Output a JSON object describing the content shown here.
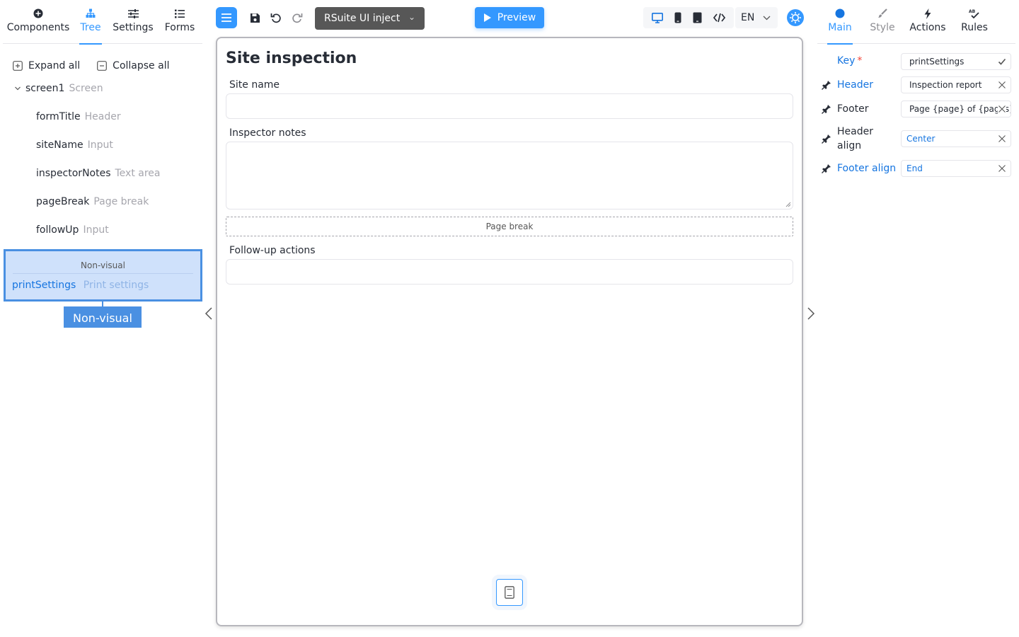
{
  "left_panel": {
    "tabs": [
      {
        "label": "Components",
        "icon": "plus-circle-icon"
      },
      {
        "label": "Tree",
        "icon": "tree-icon",
        "active": true
      },
      {
        "label": "Settings",
        "icon": "sliders-icon"
      },
      {
        "label": "Forms",
        "icon": "list-icon"
      }
    ],
    "expand_all": "Expand all",
    "collapse_all": "Collapse all",
    "tree": {
      "root": {
        "name": "screen1",
        "type": "Screen"
      },
      "children": [
        {
          "name": "formTitle",
          "type": "Header"
        },
        {
          "name": "siteName",
          "type": "Input"
        },
        {
          "name": "inspectorNotes",
          "type": "Text area"
        },
        {
          "name": "pageBreak",
          "type": "Page break"
        },
        {
          "name": "followUp",
          "type": "Input"
        }
      ]
    },
    "non_visual": {
      "header": "Non-visual",
      "item": {
        "name": "printSettings",
        "type": "Print settings"
      },
      "drop_label": "Non-visual"
    }
  },
  "toolbar": {
    "ui_kit": "RSuite UI inject",
    "preview": "Preview",
    "language": "EN",
    "accent_color": "#3498ff"
  },
  "canvas": {
    "title": "Site inspection",
    "fields": {
      "site_name": "Site name",
      "inspector_notes": "Inspector notes",
      "page_break": "Page break",
      "follow_up": "Follow-up actions"
    }
  },
  "right_panel": {
    "tabs": [
      {
        "label": "Main",
        "icon": "dot-icon",
        "active": true
      },
      {
        "label": "Style",
        "icon": "brush-icon"
      },
      {
        "label": "Actions",
        "icon": "lightning-icon"
      },
      {
        "label": "Rules",
        "icon": "spellcheck-icon"
      }
    ],
    "props": {
      "key": {
        "label": "Key",
        "value": "printSettings"
      },
      "header": {
        "label": "Header",
        "value": "Inspection report"
      },
      "footer": {
        "label": "Footer",
        "value": "Page {page} of {pages}"
      },
      "header_align": {
        "label": "Header align",
        "value": "Center"
      },
      "footer_align": {
        "label": "Footer align",
        "value": "End"
      }
    }
  }
}
